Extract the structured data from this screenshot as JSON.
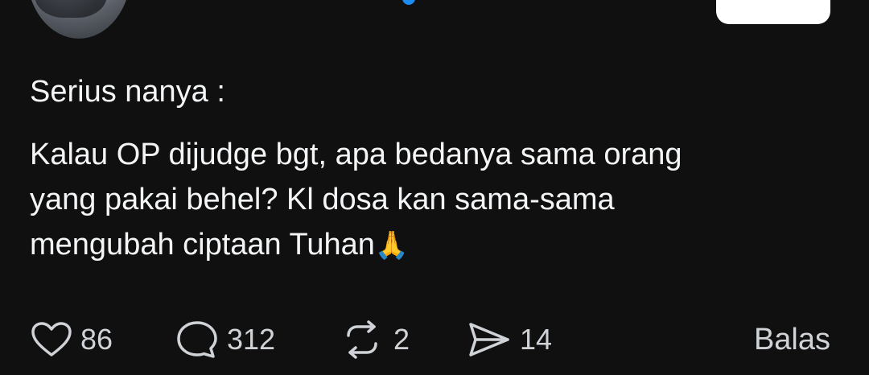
{
  "post": {
    "paragraph_1": "Serius nanya :",
    "paragraph_2_line_1": "Kalau OP dijudge bgt, apa bedanya sama orang",
    "paragraph_2_line_2": "yang pakai behel? Kl dosa kan sama-sama",
    "paragraph_2_line_3": "mengubah ciptaan Tuhan",
    "emoji": "🙏"
  },
  "actions": {
    "likes": "86",
    "comments": "312",
    "reposts": "2",
    "shares": "14",
    "reply_label": "Balas"
  },
  "icons": {
    "like": "heart-icon",
    "comment": "comment-bubble-icon",
    "repost": "repost-icon",
    "share": "send-icon"
  },
  "colors": {
    "background": "#101010",
    "text": "#f3f5f7",
    "muted": "#cfd2d6",
    "verified": "#1d8cf0"
  }
}
